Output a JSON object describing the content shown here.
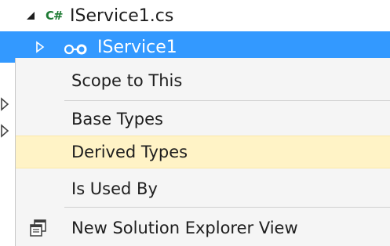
{
  "tree": {
    "file_item": {
      "icon": "csharp-file-icon",
      "icon_text": "C#",
      "label": "IService1.cs"
    },
    "interface_item": {
      "icon": "interface-icon",
      "label": "IService1",
      "selected_bg": "#3399ff"
    }
  },
  "context_menu": {
    "items": [
      {
        "label": "Scope to This"
      },
      {
        "label": "Base Types"
      },
      {
        "label": "Derived Types",
        "highlighted": true
      },
      {
        "label": "Is Used By"
      },
      {
        "label": "New Solution Explorer View",
        "icon": "new-window-icon"
      }
    ],
    "highlight_color": "#fff3c6"
  }
}
